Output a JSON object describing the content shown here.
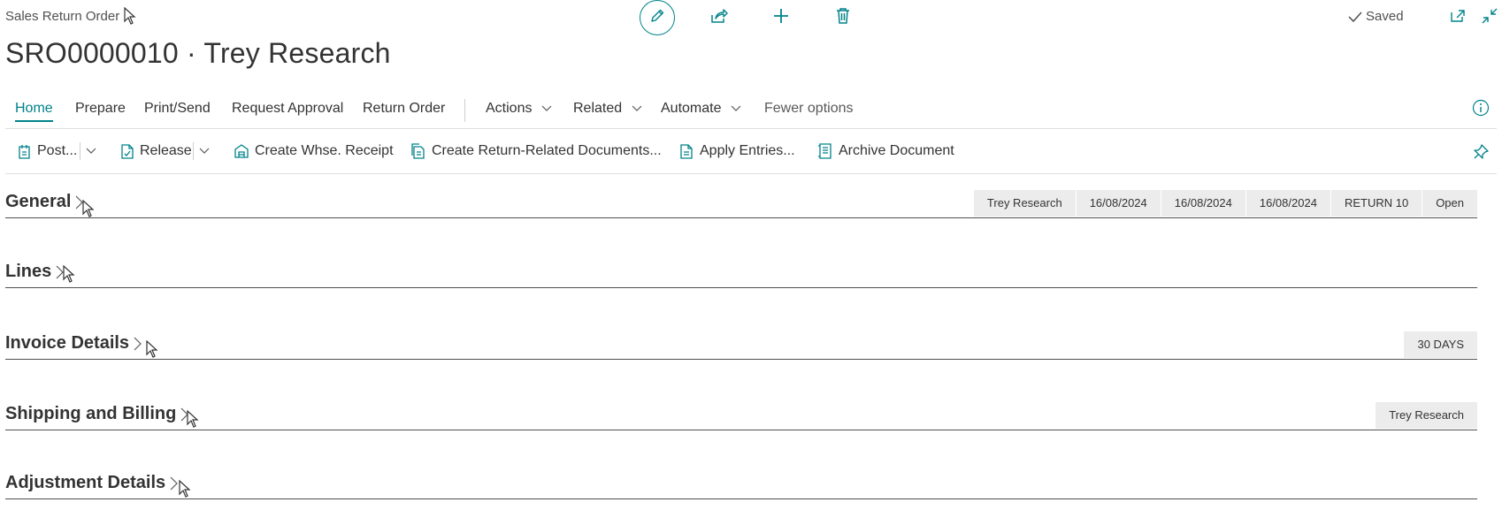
{
  "app": {
    "title": "Sales Return Order",
    "record_title": "SRO0000010 · Trey Research",
    "status_text": "Saved"
  },
  "top_actions": {
    "edit_icon": "pencil-icon",
    "share_icon": "share-icon",
    "new_icon": "plus-icon",
    "delete_icon": "trash-icon",
    "open_new_window_icon": "open-new-window-icon",
    "collapse_icon": "collapse-icon"
  },
  "tabs": [
    {
      "label": "Home"
    },
    {
      "label": "Prepare"
    },
    {
      "label": "Print/Send"
    },
    {
      "label": "Request Approval"
    },
    {
      "label": "Return Order"
    },
    {
      "label": "Actions"
    },
    {
      "label": "Related"
    },
    {
      "label": "Automate"
    },
    {
      "label": "Fewer options"
    }
  ],
  "actions": {
    "post": "Post...",
    "release": "Release",
    "create_whse_receipt": "Create Whse. Receipt",
    "create_return_related": "Create Return-Related Documents...",
    "apply_entries": "Apply Entries...",
    "archive_document": "Archive Document"
  },
  "sections": {
    "general": {
      "title": "General",
      "badges": [
        "Trey Research",
        "16/08/2024",
        "16/08/2024",
        "16/08/2024",
        "RETURN 10",
        "Open"
      ]
    },
    "lines": {
      "title": "Lines"
    },
    "invoice_details": {
      "title": "Invoice Details",
      "badges": [
        "30 DAYS"
      ]
    },
    "shipping_billing": {
      "title": "Shipping and Billing",
      "badges": [
        "Trey Research"
      ]
    },
    "adjustment_details": {
      "title": "Adjustment Details"
    }
  },
  "colors": {
    "accent": "#00838a",
    "text": "#333333",
    "badge_bg": "#ececec"
  }
}
